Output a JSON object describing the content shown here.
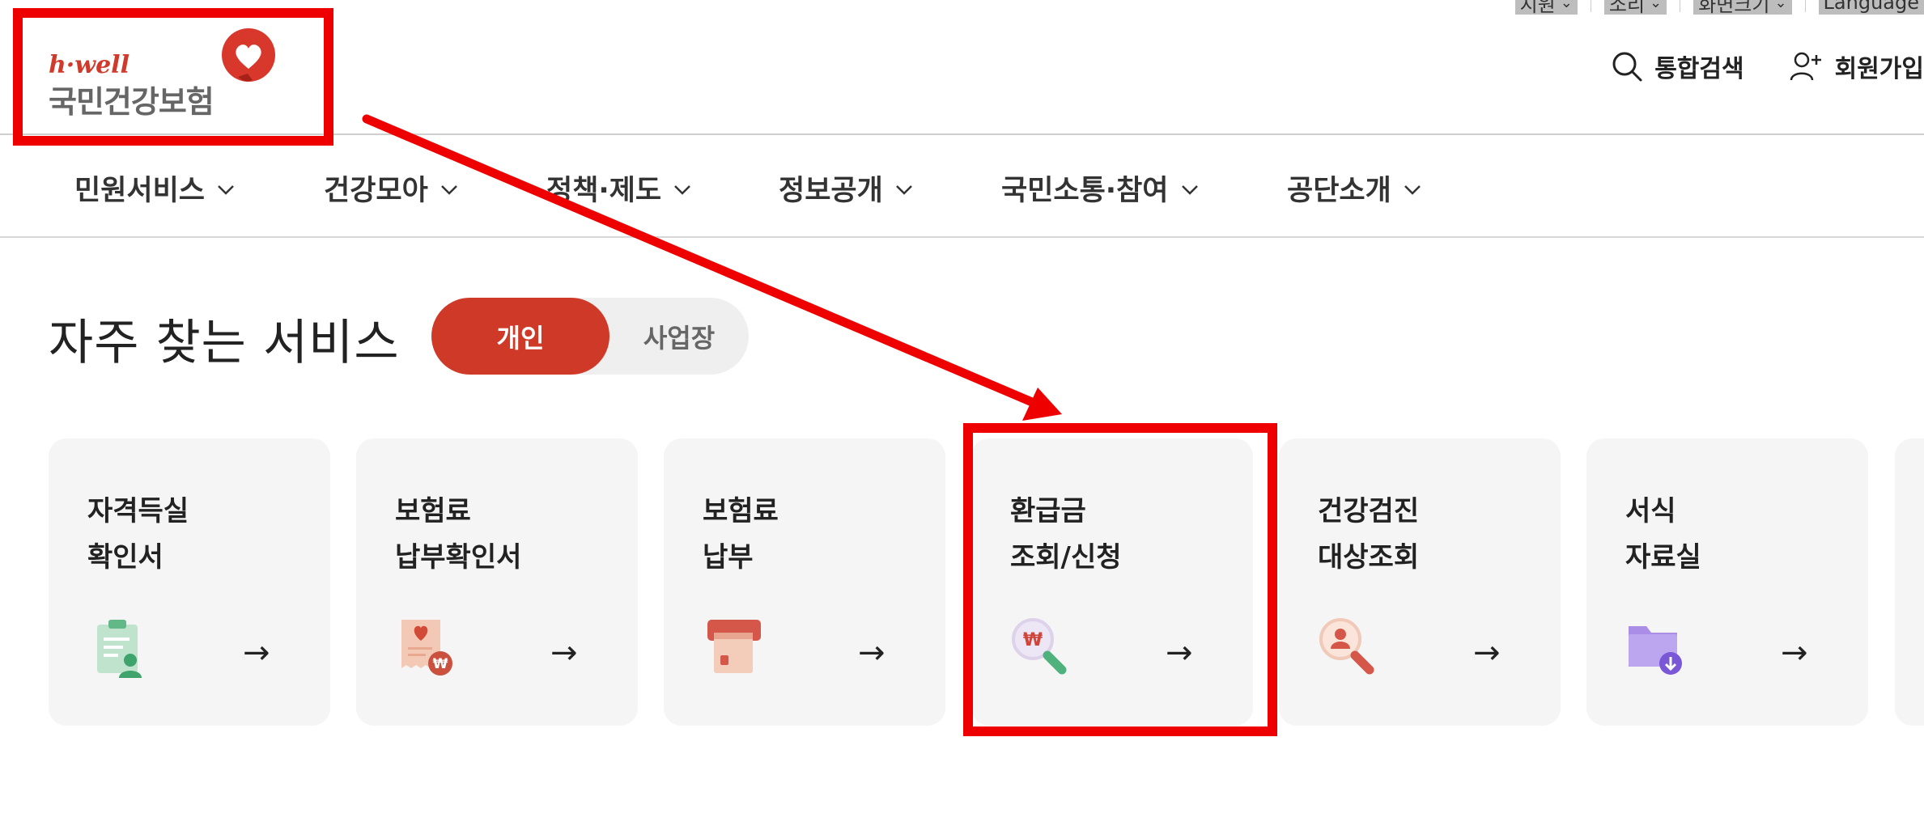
{
  "util_bar": {
    "items": [
      "지원",
      "소리",
      "화면크기",
      "Language"
    ]
  },
  "logo": {
    "tagline": "h·well",
    "name": "국민건강보험"
  },
  "header": {
    "search_label": "통합검색",
    "signup_label": "회원가입"
  },
  "nav": {
    "items": [
      "민원서비스",
      "건강모아",
      "정책·제도",
      "정보공개",
      "국민소통·참여",
      "공단소개"
    ]
  },
  "section": {
    "title": "자주 찾는 서비스",
    "toggle_active": "개인",
    "toggle_inactive": "사업장"
  },
  "cards": [
    {
      "line1": "자격득실",
      "line2": "확인서",
      "icon": "certificate-icon"
    },
    {
      "line1": "보험료",
      "line2": "납부확인서",
      "icon": "receipt-won-icon"
    },
    {
      "line1": "보험료",
      "line2": "납부",
      "icon": "payment-card-icon"
    },
    {
      "line1": "환급금",
      "line2": "조회/신청",
      "icon": "won-magnifier-icon"
    },
    {
      "line1": "건강검진",
      "line2": "대상조회",
      "icon": "person-magnifier-icon"
    },
    {
      "line1": "서식",
      "line2": "자료실",
      "icon": "folder-download-icon"
    }
  ],
  "arrow_glyph": "→",
  "colors": {
    "brand_red": "#cf3a28",
    "annotation_red": "#ee0000",
    "card_bg": "#f5f5f5"
  }
}
